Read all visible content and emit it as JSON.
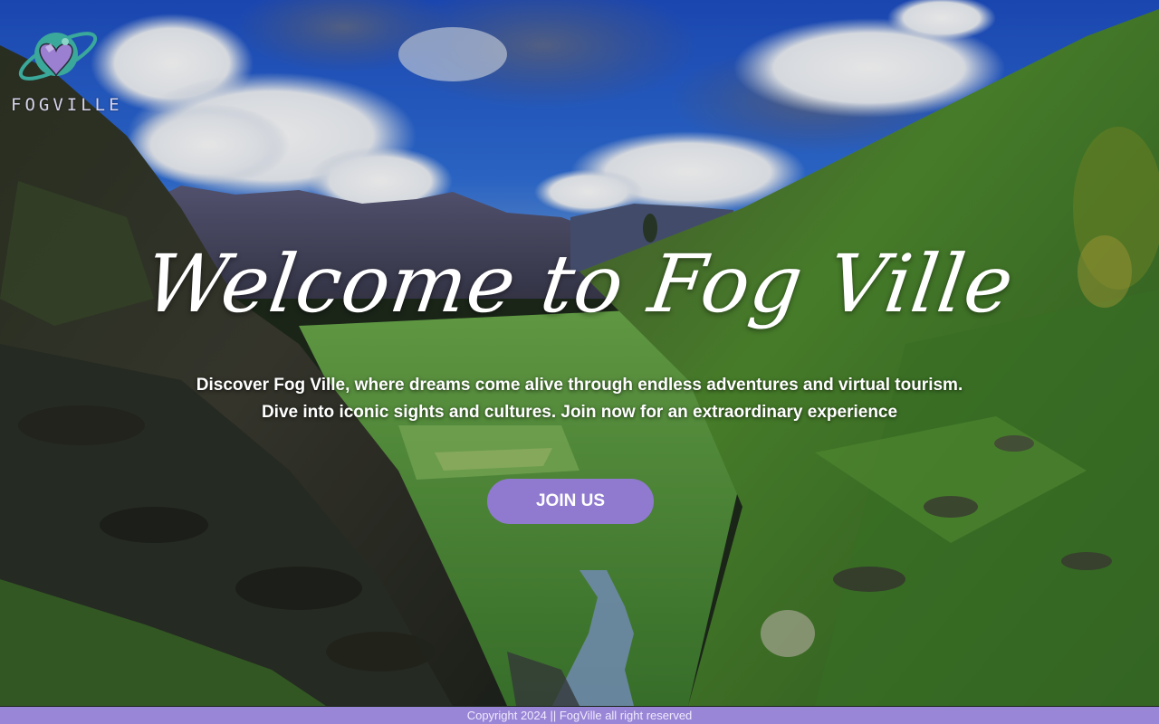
{
  "brand": {
    "logo_icon": "globe-heart-icon",
    "name": "FOGVILLE"
  },
  "hero": {
    "title": "Welcome to Fog Ville",
    "description_line1": "Discover Fog Ville, where dreams come alive through endless adventures and virtual tourism.",
    "description_line2": "Dive into iconic sights and cultures. Join now for an extraordinary experience",
    "background": "mountain-valley-photo"
  },
  "cta": {
    "join_label": "JOIN US"
  },
  "footer": {
    "copyright": "Copyright 2024 || FogVille  all right reserved"
  },
  "colors": {
    "accent": "#8f7ad0",
    "footer": "#9a86d6",
    "logo_teal": "#3aa89a",
    "logo_purple": "#9b7fd0"
  }
}
